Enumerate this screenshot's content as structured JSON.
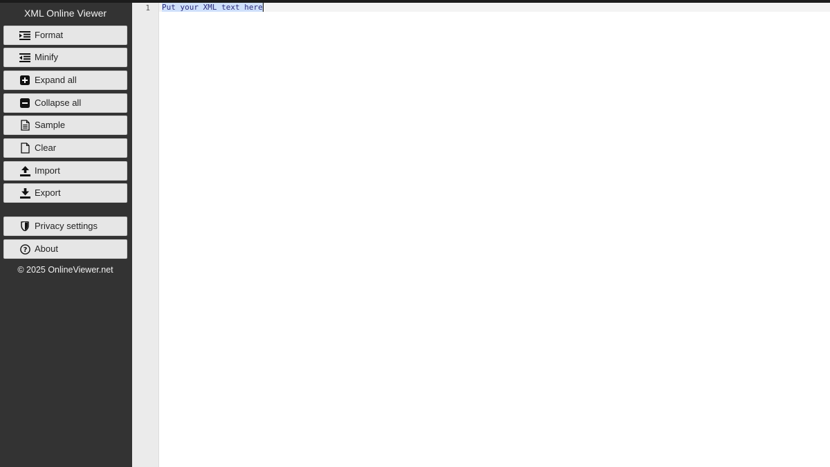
{
  "app": {
    "title": "XML Online Viewer",
    "copyright": "© 2025 OnlineViewer.net"
  },
  "toolbar": {
    "format": {
      "label": "Format",
      "icon": "format-indent-icon"
    },
    "minify": {
      "label": "Minify",
      "icon": "minify-outdent-icon"
    },
    "expand_all": {
      "label": "Expand all",
      "icon": "plus-square-icon"
    },
    "collapse_all": {
      "label": "Collapse all",
      "icon": "minus-square-icon"
    },
    "sample": {
      "label": "Sample",
      "icon": "document-lines-icon"
    },
    "clear": {
      "label": "Clear",
      "icon": "blank-document-icon"
    },
    "import": {
      "label": "Import",
      "icon": "upload-icon"
    },
    "export": {
      "label": "Export",
      "icon": "download-icon"
    },
    "privacy": {
      "label": "Privacy settings",
      "icon": "shield-icon"
    },
    "about": {
      "label": "About",
      "icon": "question-circle-icon"
    }
  },
  "editor": {
    "line_numbers": [
      "1"
    ],
    "lines": [
      "Put your XML text here"
    ]
  },
  "colors": {
    "sidebar_bg": "#333333",
    "button_bg": "#e6e6e6",
    "gutter_bg": "#ebebeb",
    "selection": "#cfe0fb"
  }
}
